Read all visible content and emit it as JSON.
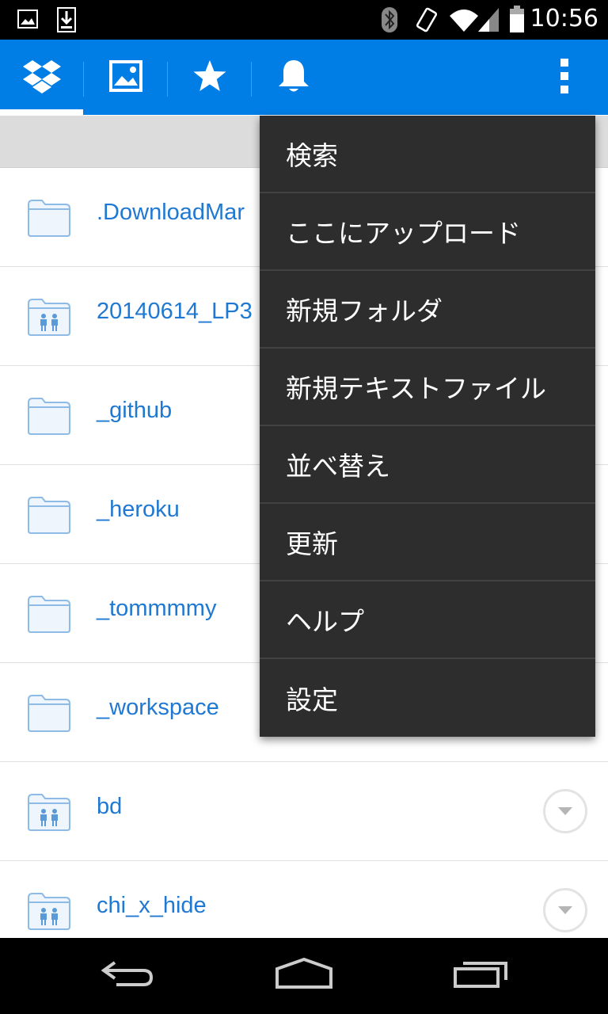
{
  "status_bar": {
    "time": "10:56",
    "icons": [
      "image-notification-icon",
      "download-notification-icon",
      "bluetooth-icon",
      "vibrate-icon",
      "wifi-icon",
      "cell-signal-icon",
      "battery-icon"
    ]
  },
  "action_bar": {
    "tabs": [
      {
        "icon": "dropbox-icon",
        "active": true
      },
      {
        "icon": "photos-icon",
        "active": false
      },
      {
        "icon": "star-icon",
        "active": false
      },
      {
        "icon": "bell-icon",
        "active": false
      }
    ],
    "overflow_icon": "overflow-menu-icon",
    "color": "#007ee5"
  },
  "files": [
    {
      "name": ".DownloadMar",
      "shared": false,
      "has_menu": false
    },
    {
      "name": "20140614_LP3",
      "shared": true,
      "has_menu": false
    },
    {
      "name": "_github",
      "shared": false,
      "has_menu": false
    },
    {
      "name": "_heroku",
      "shared": false,
      "has_menu": false
    },
    {
      "name": "_tommmmy",
      "shared": false,
      "has_menu": false
    },
    {
      "name": "_workspace",
      "shared": false,
      "has_menu": false
    },
    {
      "name": "bd",
      "shared": true,
      "has_menu": true
    },
    {
      "name": "chi_x_hide",
      "shared": true,
      "has_menu": true
    }
  ],
  "menu": {
    "items": [
      "検索",
      "ここにアップロード",
      "新規フォルダ",
      "新規テキストファイル",
      "並べ替え",
      "更新",
      "ヘルプ",
      "設定"
    ]
  },
  "nav_bar": {
    "buttons": [
      "back-icon",
      "home-icon",
      "recents-icon"
    ]
  }
}
